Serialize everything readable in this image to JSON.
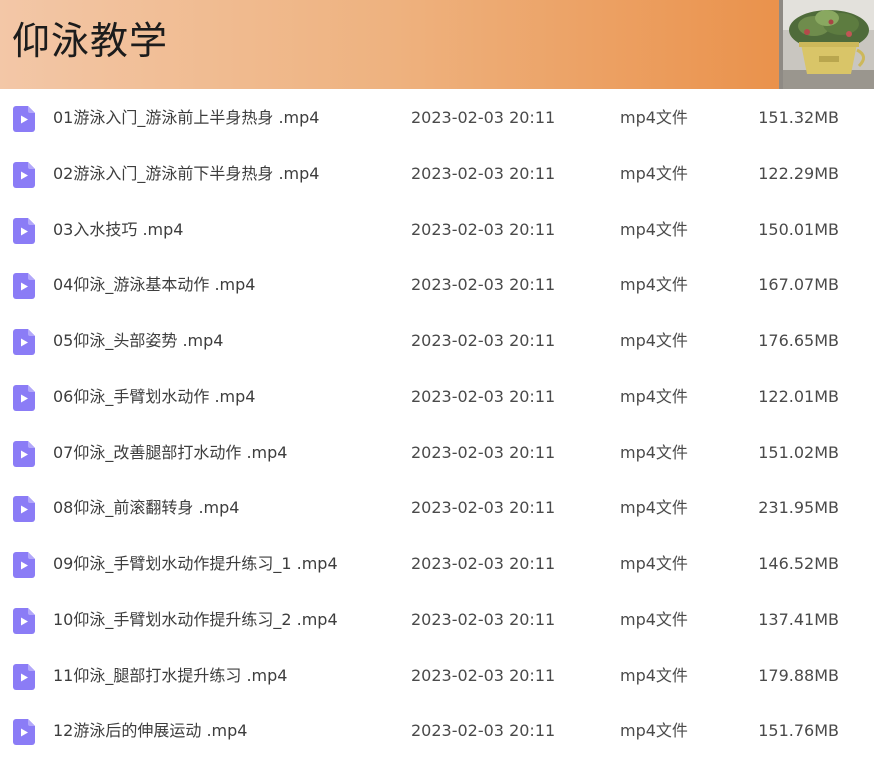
{
  "header": {
    "title": "仰泳教学"
  },
  "colors": {
    "icon": "#8b7cf6",
    "header_start": "#f3c7a7",
    "header_end": "#e98a3f"
  },
  "files": [
    {
      "name": "01游泳入门_游泳前上半身热身 .mp4",
      "date": "2023-02-03 20:11",
      "type": "mp4文件",
      "size": "151.32MB"
    },
    {
      "name": "02游泳入门_游泳前下半身热身 .mp4",
      "date": "2023-02-03 20:11",
      "type": "mp4文件",
      "size": "122.29MB"
    },
    {
      "name": "03入水技巧 .mp4",
      "date": "2023-02-03 20:11",
      "type": "mp4文件",
      "size": "150.01MB"
    },
    {
      "name": "04仰泳_游泳基本动作 .mp4",
      "date": "2023-02-03 20:11",
      "type": "mp4文件",
      "size": "167.07MB"
    },
    {
      "name": "05仰泳_头部姿势 .mp4",
      "date": "2023-02-03 20:11",
      "type": "mp4文件",
      "size": "176.65MB"
    },
    {
      "name": "06仰泳_手臂划水动作 .mp4",
      "date": "2023-02-03 20:11",
      "type": "mp4文件",
      "size": "122.01MB"
    },
    {
      "name": "07仰泳_改善腿部打水动作 .mp4",
      "date": "2023-02-03 20:11",
      "type": "mp4文件",
      "size": "151.02MB"
    },
    {
      "name": "08仰泳_前滚翻转身 .mp4",
      "date": "2023-02-03 20:11",
      "type": "mp4文件",
      "size": "231.95MB"
    },
    {
      "name": "09仰泳_手臂划水动作提升练习_1 .mp4",
      "date": "2023-02-03 20:11",
      "type": "mp4文件",
      "size": "146.52MB"
    },
    {
      "name": "10仰泳_手臂划水动作提升练习_2 .mp4",
      "date": "2023-02-03 20:11",
      "type": "mp4文件",
      "size": "137.41MB"
    },
    {
      "name": "11仰泳_腿部打水提升练习 .mp4",
      "date": "2023-02-03 20:11",
      "type": "mp4文件",
      "size": "179.88MB"
    },
    {
      "name": "12游泳后的伸展运动 .mp4",
      "date": "2023-02-03 20:11",
      "type": "mp4文件",
      "size": "151.76MB"
    }
  ]
}
